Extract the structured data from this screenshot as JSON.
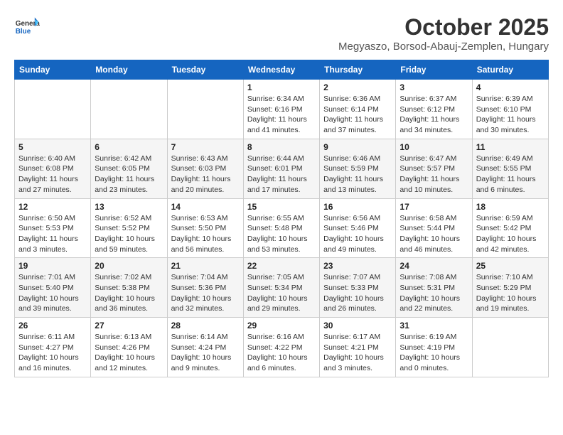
{
  "header": {
    "logo": {
      "general": "General",
      "blue": "Blue"
    },
    "title": "October 2025",
    "subtitle": "Megyaszo, Borsod-Abauj-Zemplen, Hungary"
  },
  "calendar": {
    "weekdays": [
      "Sunday",
      "Monday",
      "Tuesday",
      "Wednesday",
      "Thursday",
      "Friday",
      "Saturday"
    ],
    "rows": [
      [
        {
          "day": "",
          "detail": ""
        },
        {
          "day": "",
          "detail": ""
        },
        {
          "day": "",
          "detail": ""
        },
        {
          "day": "1",
          "detail": "Sunrise: 6:34 AM\nSunset: 6:16 PM\nDaylight: 11 hours\nand 41 minutes."
        },
        {
          "day": "2",
          "detail": "Sunrise: 6:36 AM\nSunset: 6:14 PM\nDaylight: 11 hours\nand 37 minutes."
        },
        {
          "day": "3",
          "detail": "Sunrise: 6:37 AM\nSunset: 6:12 PM\nDaylight: 11 hours\nand 34 minutes."
        },
        {
          "day": "4",
          "detail": "Sunrise: 6:39 AM\nSunset: 6:10 PM\nDaylight: 11 hours\nand 30 minutes."
        }
      ],
      [
        {
          "day": "5",
          "detail": "Sunrise: 6:40 AM\nSunset: 6:08 PM\nDaylight: 11 hours\nand 27 minutes."
        },
        {
          "day": "6",
          "detail": "Sunrise: 6:42 AM\nSunset: 6:05 PM\nDaylight: 11 hours\nand 23 minutes."
        },
        {
          "day": "7",
          "detail": "Sunrise: 6:43 AM\nSunset: 6:03 PM\nDaylight: 11 hours\nand 20 minutes."
        },
        {
          "day": "8",
          "detail": "Sunrise: 6:44 AM\nSunset: 6:01 PM\nDaylight: 11 hours\nand 17 minutes."
        },
        {
          "day": "9",
          "detail": "Sunrise: 6:46 AM\nSunset: 5:59 PM\nDaylight: 11 hours\nand 13 minutes."
        },
        {
          "day": "10",
          "detail": "Sunrise: 6:47 AM\nSunset: 5:57 PM\nDaylight: 11 hours\nand 10 minutes."
        },
        {
          "day": "11",
          "detail": "Sunrise: 6:49 AM\nSunset: 5:55 PM\nDaylight: 11 hours\nand 6 minutes."
        }
      ],
      [
        {
          "day": "12",
          "detail": "Sunrise: 6:50 AM\nSunset: 5:53 PM\nDaylight: 11 hours\nand 3 minutes."
        },
        {
          "day": "13",
          "detail": "Sunrise: 6:52 AM\nSunset: 5:52 PM\nDaylight: 10 hours\nand 59 minutes."
        },
        {
          "day": "14",
          "detail": "Sunrise: 6:53 AM\nSunset: 5:50 PM\nDaylight: 10 hours\nand 56 minutes."
        },
        {
          "day": "15",
          "detail": "Sunrise: 6:55 AM\nSunset: 5:48 PM\nDaylight: 10 hours\nand 53 minutes."
        },
        {
          "day": "16",
          "detail": "Sunrise: 6:56 AM\nSunset: 5:46 PM\nDaylight: 10 hours\nand 49 minutes."
        },
        {
          "day": "17",
          "detail": "Sunrise: 6:58 AM\nSunset: 5:44 PM\nDaylight: 10 hours\nand 46 minutes."
        },
        {
          "day": "18",
          "detail": "Sunrise: 6:59 AM\nSunset: 5:42 PM\nDaylight: 10 hours\nand 42 minutes."
        }
      ],
      [
        {
          "day": "19",
          "detail": "Sunrise: 7:01 AM\nSunset: 5:40 PM\nDaylight: 10 hours\nand 39 minutes."
        },
        {
          "day": "20",
          "detail": "Sunrise: 7:02 AM\nSunset: 5:38 PM\nDaylight: 10 hours\nand 36 minutes."
        },
        {
          "day": "21",
          "detail": "Sunrise: 7:04 AM\nSunset: 5:36 PM\nDaylight: 10 hours\nand 32 minutes."
        },
        {
          "day": "22",
          "detail": "Sunrise: 7:05 AM\nSunset: 5:34 PM\nDaylight: 10 hours\nand 29 minutes."
        },
        {
          "day": "23",
          "detail": "Sunrise: 7:07 AM\nSunset: 5:33 PM\nDaylight: 10 hours\nand 26 minutes."
        },
        {
          "day": "24",
          "detail": "Sunrise: 7:08 AM\nSunset: 5:31 PM\nDaylight: 10 hours\nand 22 minutes."
        },
        {
          "day": "25",
          "detail": "Sunrise: 7:10 AM\nSunset: 5:29 PM\nDaylight: 10 hours\nand 19 minutes."
        }
      ],
      [
        {
          "day": "26",
          "detail": "Sunrise: 6:11 AM\nSunset: 4:27 PM\nDaylight: 10 hours\nand 16 minutes."
        },
        {
          "day": "27",
          "detail": "Sunrise: 6:13 AM\nSunset: 4:26 PM\nDaylight: 10 hours\nand 12 minutes."
        },
        {
          "day": "28",
          "detail": "Sunrise: 6:14 AM\nSunset: 4:24 PM\nDaylight: 10 hours\nand 9 minutes."
        },
        {
          "day": "29",
          "detail": "Sunrise: 6:16 AM\nSunset: 4:22 PM\nDaylight: 10 hours\nand 6 minutes."
        },
        {
          "day": "30",
          "detail": "Sunrise: 6:17 AM\nSunset: 4:21 PM\nDaylight: 10 hours\nand 3 minutes."
        },
        {
          "day": "31",
          "detail": "Sunrise: 6:19 AM\nSunset: 4:19 PM\nDaylight: 10 hours\nand 0 minutes."
        },
        {
          "day": "",
          "detail": ""
        }
      ]
    ]
  }
}
